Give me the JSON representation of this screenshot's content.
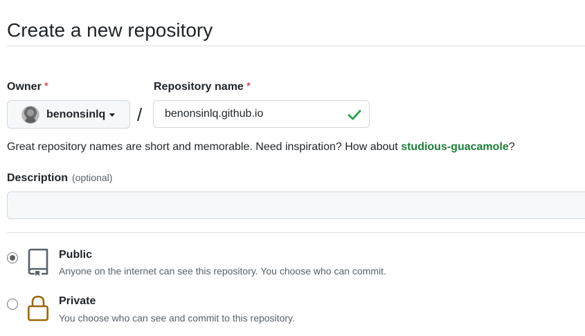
{
  "page": {
    "title": "Create a new repository"
  },
  "owner": {
    "label": "Owner",
    "required_mark": "*",
    "selected": "benonsinlq"
  },
  "separator": "/",
  "repository_name": {
    "label": "Repository name",
    "required_mark": "*",
    "value": "benonsinlq.github.io",
    "valid": true
  },
  "name_hint": {
    "text": "Great repository names are short and memorable. Need inspiration? How about ",
    "suggestion": "studious-guacamole",
    "suffix": "?"
  },
  "description": {
    "label": "Description",
    "optional": "(optional)",
    "value": ""
  },
  "visibility": {
    "selected": "public",
    "options": [
      {
        "key": "public",
        "title": "Public",
        "description": "Anyone on the internet can see this repository. You choose who can commit.",
        "icon": "repo-book-icon"
      },
      {
        "key": "private",
        "title": "Private",
        "description": "You choose who can see and commit to this repository.",
        "icon": "lock-icon"
      }
    ]
  },
  "colors": {
    "text": "#1f2328",
    "muted": "#57606a",
    "border": "#d0d7de",
    "required": "#cf222e",
    "success": "#1a7f37",
    "check": "#2da44e",
    "lock": "#9a6700"
  }
}
